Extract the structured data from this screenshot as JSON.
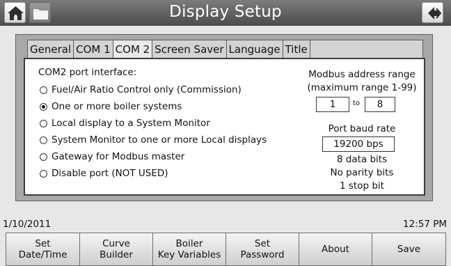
{
  "window": {
    "title": "Display Setup"
  },
  "icons": {
    "home": "home-icon",
    "folder": "folder-icon",
    "back": "back-arrow-icon"
  },
  "tabs": [
    {
      "label": "General",
      "active": false
    },
    {
      "label": "COM 1",
      "active": false
    },
    {
      "label": "COM 2",
      "active": true
    },
    {
      "label": "Screen Saver",
      "active": false
    },
    {
      "label": "Language",
      "active": false
    },
    {
      "label": "Title",
      "active": false
    }
  ],
  "com2": {
    "section_label": "COM2 port interface:",
    "options": [
      {
        "label": "Fuel/Air Ratio Control only (Commission)",
        "selected": false
      },
      {
        "label": "One or more boiler systems",
        "selected": true
      },
      {
        "label": "Local display to a System Monitor",
        "selected": false
      },
      {
        "label": "System Monitor to one or more Local displays",
        "selected": false
      },
      {
        "label": "Gateway for Modbus master",
        "selected": false
      },
      {
        "label": "Disable port (NOT USED)",
        "selected": false
      }
    ],
    "modbus": {
      "title": "Modbus address range",
      "subtitle": "(maximum range 1-99)",
      "from": "1",
      "to_label": "to",
      "to": "8"
    },
    "baud": {
      "title": "Port baud rate",
      "value": "19200 bps",
      "data_bits": "8 data bits",
      "parity": "No parity bits",
      "stop_bits": "1 stop bit"
    }
  },
  "status": {
    "date": "1/10/2011",
    "time": "12:57 PM"
  },
  "buttons": [
    {
      "label": "Set\nDate/Time"
    },
    {
      "label": "Curve\nBuilder"
    },
    {
      "label": "Boiler\nKey Variables"
    },
    {
      "label": "Set\nPassword"
    },
    {
      "label": "About"
    },
    {
      "label": "Save"
    }
  ],
  "colors": {
    "title_bar": "#5e5e5e",
    "panel": "#a8a8a8",
    "content": "#ffffff"
  }
}
